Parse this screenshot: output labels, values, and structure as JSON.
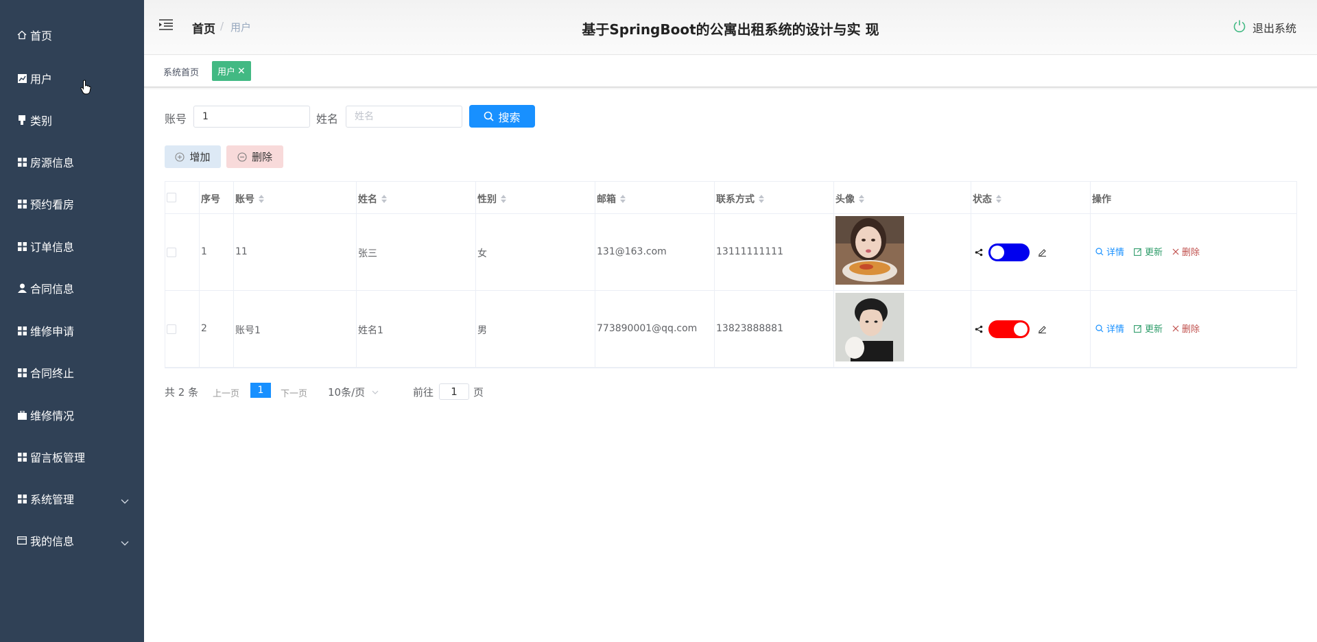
{
  "sidebar": {
    "items": [
      {
        "label": "首页",
        "icon": "home-icon"
      },
      {
        "label": "用户",
        "icon": "chart-icon"
      },
      {
        "label": "类别",
        "icon": "tag-icon"
      },
      {
        "label": "房源信息",
        "icon": "grid-icon"
      },
      {
        "label": "预约看房",
        "icon": "grid-icon"
      },
      {
        "label": "订单信息",
        "icon": "grid-icon"
      },
      {
        "label": "合同信息",
        "icon": "user-icon"
      },
      {
        "label": "维修申请",
        "icon": "grid-icon"
      },
      {
        "label": "合同终止",
        "icon": "grid-icon"
      },
      {
        "label": "维修情况",
        "icon": "briefcase-icon"
      },
      {
        "label": "留言板管理",
        "icon": "grid-icon"
      },
      {
        "label": "系统管理",
        "icon": "grid-icon"
      },
      {
        "label": "我的信息",
        "icon": "card-icon"
      }
    ],
    "bg_color": "#304156"
  },
  "header": {
    "breadcrumb_home": "首页",
    "breadcrumb_separator": "/",
    "breadcrumb_current": "用户",
    "title": "基于SpringBoot的公寓出租系统的设计与实 现",
    "logout_label": "退出系统"
  },
  "tags": {
    "home": "系统首页",
    "active": "用户",
    "active_color": "#42b983"
  },
  "search": {
    "account_label": "账号",
    "account_value": "1",
    "name_label": "姓名",
    "name_placeholder": "姓名",
    "search_button": "搜索",
    "accent": "#1890ff"
  },
  "actions": {
    "add_label": "增加",
    "delete_label": "删除"
  },
  "table": {
    "headers": {
      "index": "序号",
      "account": "账号",
      "name": "姓名",
      "gender": "性别",
      "email": "邮箱",
      "phone": "联系方式",
      "avatar": "头像",
      "status": "状态",
      "ops": "操作"
    },
    "rows": [
      {
        "index": "1",
        "account": "11",
        "name": "张三",
        "gender": "女",
        "email": "131@163.com",
        "phone": "13111111111",
        "status_color": "#0000ee"
      },
      {
        "index": "2",
        "account": "账号1",
        "name": "姓名1",
        "gender": "男",
        "email": "773890001@qq.com",
        "phone": "13823888881",
        "status_color": "#ff0000"
      }
    ],
    "op_detail": "详情",
    "op_update": "更新",
    "op_delete": "删除"
  },
  "pagination": {
    "total": "共 2 条",
    "prev": "上一页",
    "current": "1",
    "next": "下一页",
    "page_size": "10条/页",
    "goto_label": "前往",
    "goto_value": "1",
    "page_unit": "页"
  }
}
